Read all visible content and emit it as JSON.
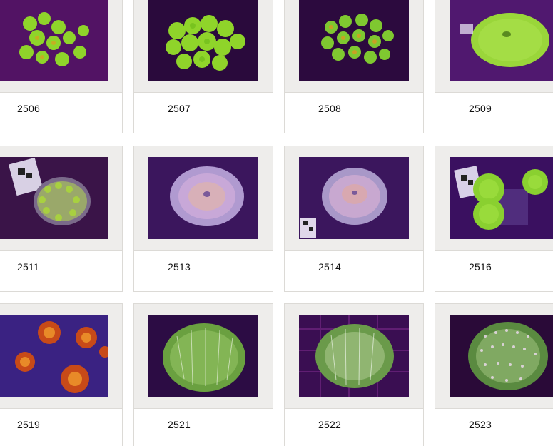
{
  "products": [
    {
      "id": "2506",
      "label": "2506",
      "image": "coral-photo",
      "tone": "green-mushroom-cluster-purple"
    },
    {
      "id": "2507",
      "label": "2507",
      "image": "coral-photo",
      "tone": "green-mushroom-cluster"
    },
    {
      "id": "2508",
      "label": "2508",
      "image": "coral-photo",
      "tone": "green-orange-mushroom-cluster"
    },
    {
      "id": "2509",
      "label": "2509",
      "image": "coral-photo",
      "tone": "green-single-mushroom"
    },
    {
      "id": "2511",
      "label": "2511",
      "image": "coral-photo",
      "tone": "purple-green-rock-with-tag"
    },
    {
      "id": "2513",
      "label": "2513",
      "image": "coral-photo",
      "tone": "lavender-mushroom"
    },
    {
      "id": "2514",
      "label": "2514",
      "image": "coral-photo",
      "tone": "lavender-mushroom-with-tag"
    },
    {
      "id": "2516",
      "label": "2516",
      "image": "coral-photo",
      "tone": "green-mushrooms-with-tag"
    },
    {
      "id": "2519",
      "label": "2519",
      "image": "coral-photo",
      "tone": "orange-red-polyps-blue"
    },
    {
      "id": "2521",
      "label": "2521",
      "image": "coral-photo",
      "tone": "green-hairy-mushroom"
    },
    {
      "id": "2522",
      "label": "2522",
      "image": "coral-photo",
      "tone": "green-hairy-mushroom"
    },
    {
      "id": "2523",
      "label": "2523",
      "image": "coral-photo",
      "tone": "green-hairy-mushroom"
    }
  ]
}
